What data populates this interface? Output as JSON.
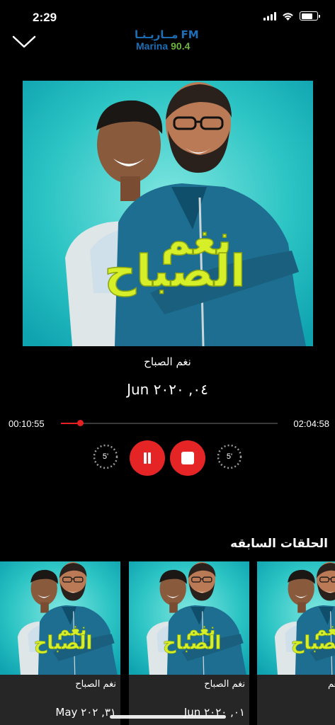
{
  "status": {
    "time": "2:29"
  },
  "logo": {
    "arabic": "مــاريـنـا",
    "fm": "FM",
    "name": "Marina",
    "frequency": "90.4"
  },
  "now_playing": {
    "title": "نغم الصباح",
    "date": "Jun ٠٤, ٢٠٢٠",
    "elapsed": "00:10:55",
    "total": "02:04:58",
    "progress": 0.0874,
    "cover_text": "نغم الصباح",
    "skip_back_label": "5'",
    "skip_forward_label": "5'"
  },
  "colors": {
    "accent": "#e52525",
    "teal": "#1fc6c6",
    "lime": "#d6ef28",
    "brand_blue": "#1e6fb8",
    "brand_green": "#6cb33f"
  },
  "previous": {
    "title": "الحلقات السابقه",
    "episodes": [
      {
        "title": "نغم الصباح",
        "date": "May ٣١, ٢٠٢"
      },
      {
        "title": "نغم الصباح",
        "date": "Jun ٠١, ٢٠٢٠"
      },
      {
        "title": "نغم",
        "date": ""
      }
    ]
  }
}
